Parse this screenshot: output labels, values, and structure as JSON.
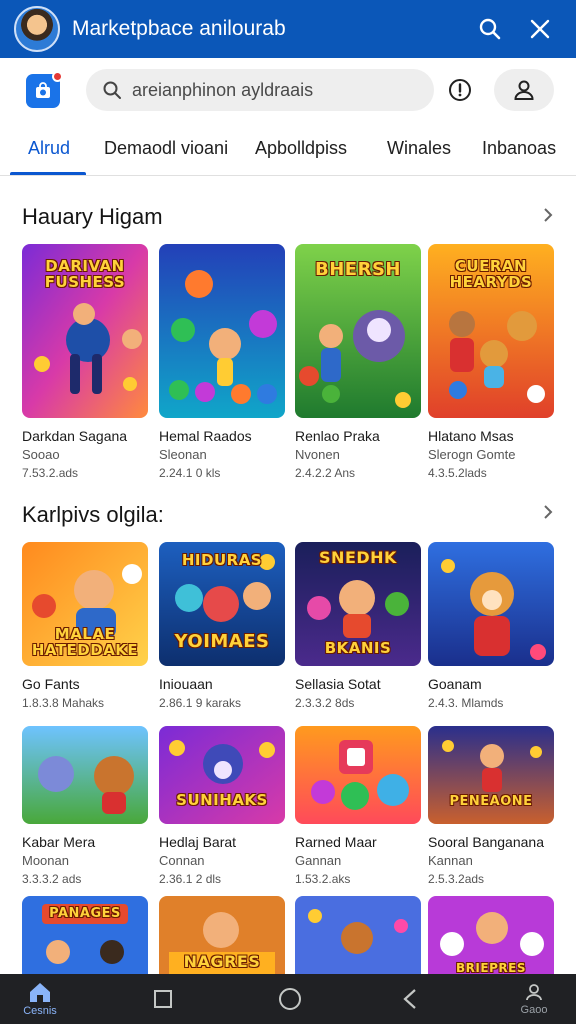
{
  "header": {
    "title": "Marketpbace anilourab",
    "colors": {
      "bar": "#0b57b8",
      "accent": "#0b57d0"
    },
    "icons": [
      "search-icon",
      "close-icon"
    ]
  },
  "search": {
    "placeholder": "areianphinon ayldraais"
  },
  "tabs": [
    {
      "label": "Alrud",
      "active": true
    },
    {
      "label": "Demaodl vioani",
      "active": false
    },
    {
      "label": "Apbolldpiss",
      "active": false
    },
    {
      "label": "Winales",
      "active": false
    },
    {
      "label": "Inbanoas",
      "active": false
    }
  ],
  "sections": [
    {
      "title": "Hauary Higam",
      "games": [
        {
          "name": "Darkdan Sagana",
          "category": "Sooao",
          "meta": "7.53.2.ads",
          "art_text": "DARIVAN FUSHESS"
        },
        {
          "name": "Hemal Raados",
          "category": "Sleonan",
          "meta": "2.24.1 0 kls",
          "art_text": ""
        },
        {
          "name": "Renlao Praka",
          "category": "Nvonen",
          "meta": "2.4.2.2 Ans",
          "art_text": "BHERSH"
        },
        {
          "name": "Hlatano Msas",
          "category": "Slerogn Gomte",
          "meta": "4.3.5.2lads",
          "art_text": "CUERAN HEARYDS"
        }
      ]
    },
    {
      "title": "Karlpivs olgila:",
      "games": [
        {
          "name": "Go Fants",
          "category": "",
          "meta": "1.8.3.8 Mahaks",
          "art_text": "MALAE HATEDDAKE"
        },
        {
          "name": "Iniouaan",
          "category": "",
          "meta": "2.86.1 9 karaks",
          "art_text": "YOIMAES"
        },
        {
          "name": "Sellasia Sotat",
          "category": "",
          "meta": "2.3.3.2 8ds",
          "art_text": "SNEDHK"
        },
        {
          "name": "Goanam",
          "category": "",
          "meta": "2.4.3. Mlamds",
          "art_text": ""
        }
      ]
    },
    {
      "title": "",
      "games": [
        {
          "name": "Kabar Mera",
          "category": "Moonan",
          "meta": "3.3.3.2 ads",
          "art_text": ""
        },
        {
          "name": "Hedlaj Barat",
          "category": "Connan",
          "meta": "2.36.1 2 dls",
          "art_text": "SUNIHAKS"
        },
        {
          "name": "Rarned Maar",
          "category": "Gannan",
          "meta": "1.53.2.aks",
          "art_text": ""
        },
        {
          "name": "Sooral Banganana",
          "category": "Kannan",
          "meta": "2.5.3.2ads",
          "art_text": "PENEAONE"
        }
      ]
    },
    {
      "title": "",
      "games": [
        {
          "name": "",
          "category": "",
          "meta": "",
          "art_text": "PANAGES"
        },
        {
          "name": "",
          "category": "",
          "meta": "",
          "art_text": "NAGRES"
        },
        {
          "name": "",
          "category": "",
          "meta": "",
          "art_text": ""
        },
        {
          "name": "",
          "category": "",
          "meta": "",
          "art_text": "BRIEPRES"
        }
      ]
    }
  ],
  "bottom_nav": [
    {
      "label": "Cesnis",
      "icon": "home-icon",
      "active": true
    },
    {
      "label": "",
      "icon": "square-icon",
      "active": false
    },
    {
      "label": "",
      "icon": "circle-icon",
      "active": false
    },
    {
      "label": "",
      "icon": "back-icon",
      "active": false
    },
    {
      "label": "Gaoo",
      "icon": "profile-icon",
      "active": false
    }
  ]
}
